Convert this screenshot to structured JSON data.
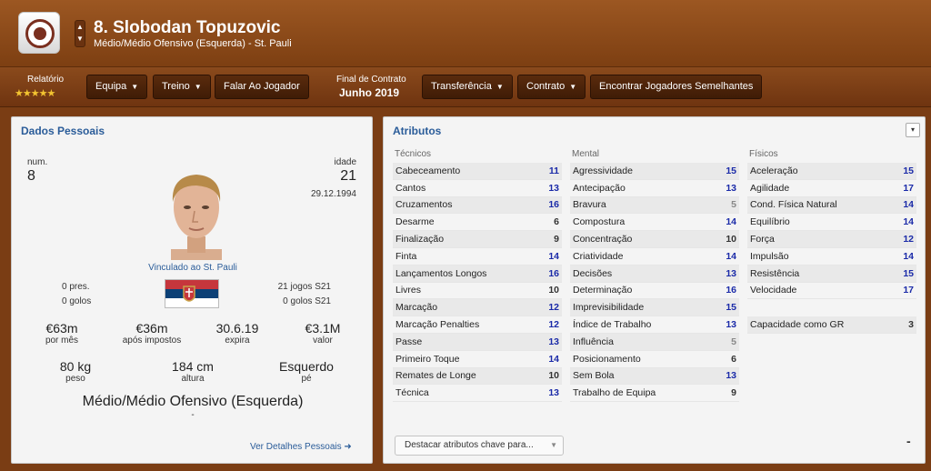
{
  "header": {
    "player_name": "8. Slobodan Topuzovic",
    "player_info": "Médio/Médio Ofensivo (Esquerda) - St. Pauli"
  },
  "toolbar": {
    "relatorio_label": "Relatório",
    "stars_text": "★★★★★",
    "rating_stars": 4.5,
    "buttons": {
      "equipa": "Equipa",
      "treino": "Treino",
      "falar": "Falar Ao Jogador",
      "transferencia": "Transferência",
      "contrato": "Contrato",
      "semelhantes": "Encontrar Jogadores Semelhantes"
    },
    "contract_label": "Final de Contrato",
    "contract_value": "Junho 2019"
  },
  "personal": {
    "title": "Dados Pessoais",
    "num_label": "num.",
    "num_value": "8",
    "age_label": "idade",
    "age_value": "21",
    "birth_date": "29.12.1994",
    "vinculado": "Vinculado ao St. Pauli",
    "pres": "0 pres.",
    "golos": "0 golos",
    "jogos_s21": "21 jogos S21",
    "golos_s21": "0 golos S21",
    "wage": "€63m",
    "wage_label": "por mês",
    "after_tax": "€36m",
    "after_tax_label": "após impostos",
    "expiry": "30.6.19",
    "expiry_label": "expira",
    "value": "€3.1M",
    "value_label": "valor",
    "weight": "80 kg",
    "weight_label": "peso",
    "height": "184 cm",
    "height_label": "altura",
    "foot": "Esquerdo",
    "foot_label": "pé",
    "position": "Médio/Médio Ofensivo (Esquerda)",
    "position_sub": "-",
    "details_link": "Ver Detalhes Pessoais ➜"
  },
  "attributes": {
    "title": "Atributos",
    "menu_icon": "▾",
    "tecnicos_label": "Técnicos",
    "mental_label": "Mental",
    "fisicos_label": "Físicos",
    "tecnicos": [
      {
        "name": "Cabeceamento",
        "value": "11",
        "color": "#1a2aa8"
      },
      {
        "name": "Cantos",
        "value": "13",
        "color": "#1a2aa8"
      },
      {
        "name": "Cruzamentos",
        "value": "16",
        "color": "#1a2aa8"
      },
      {
        "name": "Desarme",
        "value": "6",
        "color": "#333333"
      },
      {
        "name": "Finalização",
        "value": "9",
        "color": "#333333"
      },
      {
        "name": "Finta",
        "value": "14",
        "color": "#1a2aa8"
      },
      {
        "name": "Lançamentos Longos",
        "value": "16",
        "color": "#1a2aa8"
      },
      {
        "name": "Livres",
        "value": "10",
        "color": "#333333"
      },
      {
        "name": "Marcação",
        "value": "12",
        "color": "#1a2aa8"
      },
      {
        "name": "Marcação Penalties",
        "value": "12",
        "color": "#1a2aa8"
      },
      {
        "name": "Passe",
        "value": "13",
        "color": "#1a2aa8"
      },
      {
        "name": "Primeiro Toque",
        "value": "14",
        "color": "#1a2aa8"
      },
      {
        "name": "Remates de Longe",
        "value": "10",
        "color": "#333333"
      },
      {
        "name": "Técnica",
        "value": "13",
        "color": "#1a2aa8"
      }
    ],
    "mental": [
      {
        "name": "Agressividade",
        "value": "15",
        "color": "#1a2aa8"
      },
      {
        "name": "Antecipação",
        "value": "13",
        "color": "#1a2aa8"
      },
      {
        "name": "Bravura",
        "value": "5",
        "color": "#888888"
      },
      {
        "name": "Compostura",
        "value": "14",
        "color": "#1a2aa8"
      },
      {
        "name": "Concentração",
        "value": "10",
        "color": "#333333"
      },
      {
        "name": "Criatividade",
        "value": "14",
        "color": "#1a2aa8"
      },
      {
        "name": "Decisões",
        "value": "13",
        "color": "#1a2aa8"
      },
      {
        "name": "Determinação",
        "value": "16",
        "color": "#1a2aa8"
      },
      {
        "name": "Imprevisibilidade",
        "value": "15",
        "color": "#1a2aa8"
      },
      {
        "name": "Índice de Trabalho",
        "value": "13",
        "color": "#1a2aa8"
      },
      {
        "name": "Influência",
        "value": "5",
        "color": "#888888"
      },
      {
        "name": "Posicionamento",
        "value": "6",
        "color": "#333333"
      },
      {
        "name": "Sem Bola",
        "value": "13",
        "color": "#1a2aa8"
      },
      {
        "name": "Trabalho de Equipa",
        "value": "9",
        "color": "#333333"
      }
    ],
    "fisicos": [
      {
        "name": "Aceleração",
        "value": "15",
        "color": "#1a2aa8"
      },
      {
        "name": "Agilidade",
        "value": "17",
        "color": "#1a2aa8"
      },
      {
        "name": "Cond. Física Natural",
        "value": "14",
        "color": "#1a2aa8"
      },
      {
        "name": "Equilíbrio",
        "value": "14",
        "color": "#1a2aa8"
      },
      {
        "name": "Força",
        "value": "12",
        "color": "#1a2aa8"
      },
      {
        "name": "Impulsão",
        "value": "14",
        "color": "#1a2aa8"
      },
      {
        "name": "Resistência",
        "value": "15",
        "color": "#1a2aa8"
      },
      {
        "name": "Velocidade",
        "value": "17",
        "color": "#1a2aa8"
      }
    ],
    "gk_label": "Capacidade como GR",
    "gk_value": "3",
    "highlight_placeholder": "Destacar atributos chave para...",
    "minus_symbol": "-"
  },
  "colors": {
    "accent": "#2a5c99",
    "header_bg": "#9c5722",
    "flag_red": "#c6363c",
    "flag_blue": "#0c4076",
    "flag_white": "#ffffff"
  }
}
